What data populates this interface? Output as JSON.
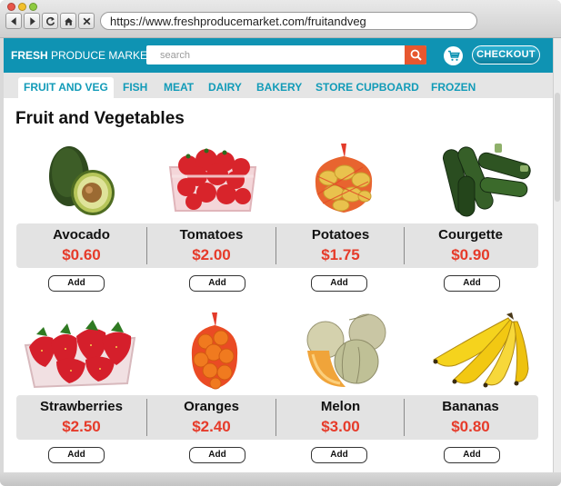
{
  "browser": {
    "url": "https://www.freshproducemarket.com/fruitandveg"
  },
  "header": {
    "logo_bold": "FRESH",
    "logo_rest": " PRODUCE MARKET",
    "search_placeholder": "search",
    "checkout_label": "CHECKOUT"
  },
  "categories": [
    {
      "label": "FRUIT AND VEG",
      "active": true
    },
    {
      "label": "FISH"
    },
    {
      "label": "MEAT"
    },
    {
      "label": "DAIRY"
    },
    {
      "label": "BAKERY"
    },
    {
      "label": "STORE CUPBOARD"
    },
    {
      "label": "FROZEN"
    }
  ],
  "page": {
    "title": "Fruit and Vegetables"
  },
  "products": [
    {
      "name": "Avocado",
      "price": "$0.60",
      "add_label": "Add"
    },
    {
      "name": "Tomatoes",
      "price": "$2.00",
      "add_label": "Add"
    },
    {
      "name": "Potatoes",
      "price": "$1.75",
      "add_label": "Add"
    },
    {
      "name": "Courgette",
      "price": "$0.90",
      "add_label": "Add"
    },
    {
      "name": "Strawberries",
      "price": "$2.50",
      "add_label": "Add"
    },
    {
      "name": "Oranges",
      "price": "$2.40",
      "add_label": "Add"
    },
    {
      "name": "Melon",
      "price": "$3.00",
      "add_label": "Add"
    },
    {
      "name": "Bananas",
      "price": "$0.80",
      "add_label": "Add"
    }
  ],
  "colors": {
    "brand": "#0f93b3",
    "price": "#e63b2a",
    "search_button": "#e7572f"
  }
}
